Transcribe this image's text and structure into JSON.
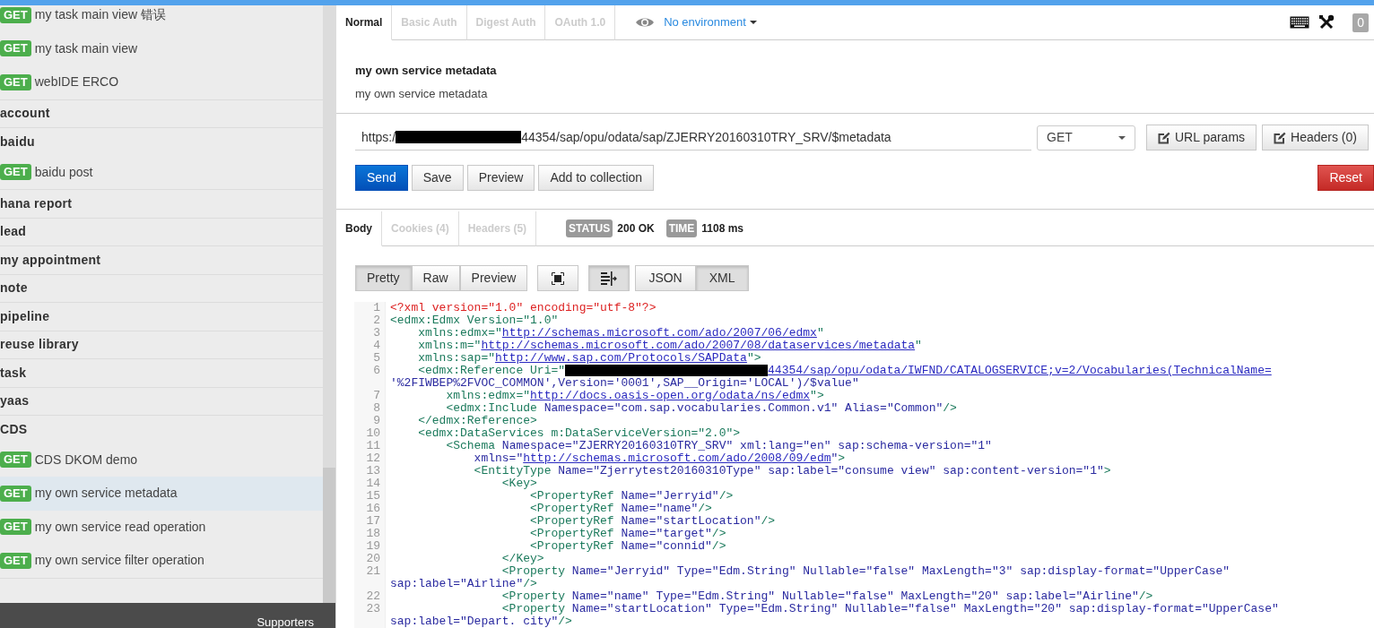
{
  "sidebar": {
    "items": [
      {
        "kind": "request",
        "method": "GET",
        "label": "my task main view 错误",
        "selected": false
      },
      {
        "kind": "request",
        "method": "GET",
        "label": "my task main view",
        "selected": false
      },
      {
        "kind": "request",
        "method": "GET",
        "label": "webIDE ERCO",
        "selected": false
      },
      {
        "kind": "folder",
        "label": "account",
        "selected": false
      },
      {
        "kind": "folder",
        "label": "baidu",
        "selected": false,
        "children": [
          {
            "kind": "request",
            "method": "GET",
            "label": "baidu post",
            "selected": false
          }
        ]
      },
      {
        "kind": "folder",
        "label": "hana report",
        "selected": false
      },
      {
        "kind": "folder",
        "label": "lead",
        "selected": false
      },
      {
        "kind": "folder",
        "label": "my appointment",
        "selected": false
      },
      {
        "kind": "folder",
        "label": "note",
        "selected": false
      },
      {
        "kind": "folder",
        "label": "pipeline",
        "selected": false
      },
      {
        "kind": "folder",
        "label": "reuse library",
        "selected": false
      },
      {
        "kind": "folder",
        "label": "task",
        "selected": false
      },
      {
        "kind": "folder",
        "label": "yaas",
        "selected": false
      },
      {
        "kind": "folder",
        "label": "CDS",
        "selected": false,
        "children": [
          {
            "kind": "request",
            "method": "GET",
            "label": "CDS DKOM demo",
            "selected": false
          },
          {
            "kind": "request",
            "method": "GET",
            "label": "my own service metadata",
            "selected": true
          },
          {
            "kind": "request",
            "method": "GET",
            "label": "my own service read operation",
            "selected": false
          },
          {
            "kind": "request",
            "method": "GET",
            "label": "my own service filter operation",
            "selected": false
          }
        ]
      }
    ],
    "footer": "Supporters"
  },
  "auth_tabs": [
    {
      "label": "Normal",
      "selected": true
    },
    {
      "label": "Basic Auth",
      "selected": false
    },
    {
      "label": "Digest Auth",
      "selected": false
    },
    {
      "label": "OAuth 1.0",
      "selected": false
    }
  ],
  "environment": "No environment",
  "counter": "0",
  "request": {
    "title": "my own service metadata",
    "description": "my own service metadata",
    "url": {
      "prefix": "https:/",
      "redacted": true,
      "suffix": "44354/sap/opu/odata/sap/ZJERRY20160310TRY_SRV/$metadata"
    },
    "method": "GET",
    "url_params": "URL params",
    "headers": "Headers (0)"
  },
  "actions": [
    {
      "label": "Send",
      "kind": "primary"
    },
    {
      "label": "Save",
      "kind": "default"
    },
    {
      "label": "Preview",
      "kind": "default"
    },
    {
      "label": "Add to collection",
      "kind": "default"
    },
    {
      "label": "Reset",
      "kind": "danger"
    }
  ],
  "response": {
    "tabs": [
      {
        "label": "Body",
        "selected": true
      },
      {
        "label": "Cookies (4)",
        "selected": false
      },
      {
        "label": "Headers (5)",
        "selected": false
      }
    ],
    "status_label": "STATUS",
    "status": "200 OK",
    "time_label": "TIME",
    "time": "1108 ms",
    "view_modes": [
      {
        "label": "Pretty",
        "selected": true
      },
      {
        "label": "Raw",
        "selected": false
      },
      {
        "label": "Preview",
        "selected": false
      }
    ],
    "fullscreen_on": false,
    "wrap_on": true,
    "formats": [
      {
        "label": "JSON",
        "selected": false
      },
      {
        "label": "XML",
        "selected": true
      }
    ],
    "code": [
      {
        "number": "1",
        "segments": [
          {
            "kind": "decl",
            "text": "<?xml version=\"1.0\" encoding=\"utf-8\"?>"
          }
        ]
      },
      {
        "number": "2",
        "segments": [
          {
            "kind": "tag",
            "text": "<edmx:Edmx Version=\"1.0\""
          }
        ]
      },
      {
        "number": "3",
        "segments": [
          {
            "kind": "tag",
            "text": "    xmlns:edmx=\""
          },
          {
            "kind": "link",
            "text": "http://schemas.microsoft.com/ado/2007/06/edmx"
          },
          {
            "kind": "tag",
            "text": "\""
          }
        ]
      },
      {
        "number": "4",
        "segments": [
          {
            "kind": "tag",
            "text": "    xmlns:m=\""
          },
          {
            "kind": "link",
            "text": "http://schemas.microsoft.com/ado/2007/08/dataservices/metadata"
          },
          {
            "kind": "tag",
            "text": "\""
          }
        ]
      },
      {
        "number": "5",
        "segments": [
          {
            "kind": "tag",
            "text": "    xmlns:sap=\""
          },
          {
            "kind": "link",
            "text": "http://www.sap.com/Protocols/SAPData"
          },
          {
            "kind": "tag",
            "text": "\">"
          }
        ]
      },
      {
        "number": "6",
        "segments": [
          {
            "kind": "tag",
            "text": "    <edmx:Reference Uri=\""
          },
          {
            "kind": "redacted"
          },
          {
            "kind": "link",
            "text": "44354/sap/opu/odata/IWFND/CATALOGSERVICE;v=2/Vocabularies(TechnicalName="
          }
        ]
      },
      {
        "segments": [
          {
            "kind": "attr",
            "text": "'%2FIWBEP%2FVOC_COMMON',Version='0001',SAP__Origin='LOCAL')/$value\""
          }
        ]
      },
      {
        "number": "7",
        "segments": [
          {
            "kind": "tag",
            "text": "        xmlns:edmx=\""
          },
          {
            "kind": "link",
            "text": "http://docs.oasis-open.org/odata/ns/edmx"
          },
          {
            "kind": "tag",
            "text": "\">"
          }
        ]
      },
      {
        "number": "8",
        "segments": [
          {
            "kind": "tag",
            "text": "        <edmx:Include"
          },
          {
            "kind": "attr",
            "text": " Namespace=\"com.sap.vocabularies.Common.v1\" Alias=\"Common\""
          },
          {
            "kind": "tag",
            "text": "/>"
          }
        ]
      },
      {
        "number": "9",
        "segments": [
          {
            "kind": "tag",
            "text": "    </edmx:Reference>"
          }
        ]
      },
      {
        "number": "10",
        "segments": [
          {
            "kind": "tag",
            "text": "    <edmx:DataServices m:DataServiceVersion=\"2.0\">"
          }
        ]
      },
      {
        "number": "11",
        "segments": [
          {
            "kind": "tag",
            "text": "        <Schema"
          },
          {
            "kind": "attr",
            "text": " Namespace=\"ZJERRY20160310TRY_SRV\" xml:lang=\"en\" sap:schema-version=\"1\""
          }
        ]
      },
      {
        "number": "12",
        "segments": [
          {
            "kind": "attr",
            "text": "            xmlns=\""
          },
          {
            "kind": "link",
            "text": "http://schemas.microsoft.com/ado/2008/09/edm"
          },
          {
            "kind": "attr",
            "text": "\""
          },
          {
            "kind": "tag",
            "text": ">"
          }
        ]
      },
      {
        "number": "13",
        "segments": [
          {
            "kind": "tag",
            "text": "            <EntityType"
          },
          {
            "kind": "attr",
            "text": " Name=\"Zjerrytest20160310Type\" sap:label=\"consume view\" sap:content-version=\"1\""
          },
          {
            "kind": "tag",
            "text": ">"
          }
        ]
      },
      {
        "number": "14",
        "segments": [
          {
            "kind": "tag",
            "text": "                <Key>"
          }
        ]
      },
      {
        "number": "15",
        "segments": [
          {
            "kind": "tag",
            "text": "                    <PropertyRef"
          },
          {
            "kind": "attr",
            "text": " Name=\"Jerryid\""
          },
          {
            "kind": "tag",
            "text": "/>"
          }
        ]
      },
      {
        "number": "16",
        "segments": [
          {
            "kind": "tag",
            "text": "                    <PropertyRef"
          },
          {
            "kind": "attr",
            "text": " Name=\"name\""
          },
          {
            "kind": "tag",
            "text": "/>"
          }
        ]
      },
      {
        "number": "17",
        "segments": [
          {
            "kind": "tag",
            "text": "                    <PropertyRef"
          },
          {
            "kind": "attr",
            "text": " Name=\"startLocation\""
          },
          {
            "kind": "tag",
            "text": "/>"
          }
        ]
      },
      {
        "number": "18",
        "segments": [
          {
            "kind": "tag",
            "text": "                    <PropertyRef"
          },
          {
            "kind": "attr",
            "text": " Name=\"target\""
          },
          {
            "kind": "tag",
            "text": "/>"
          }
        ]
      },
      {
        "number": "19",
        "segments": [
          {
            "kind": "tag",
            "text": "                    <PropertyRef"
          },
          {
            "kind": "attr",
            "text": " Name=\"connid\""
          },
          {
            "kind": "tag",
            "text": "/>"
          }
        ]
      },
      {
        "number": "20",
        "segments": [
          {
            "kind": "tag",
            "text": "                </Key>"
          }
        ]
      },
      {
        "number": "21",
        "segments": [
          {
            "kind": "tag",
            "text": "                <Property"
          },
          {
            "kind": "attr",
            "text": " Name=\"Jerryid\" Type=\"Edm.String\" Nullable=\"false\" MaxLength=\"3\" sap:display-format=\"UpperCase\""
          }
        ]
      },
      {
        "segments": [
          {
            "kind": "attr",
            "text": "sap:label=\"Airline\""
          },
          {
            "kind": "tag",
            "text": "/>"
          }
        ]
      },
      {
        "number": "22",
        "segments": [
          {
            "kind": "tag",
            "text": "                <Property"
          },
          {
            "kind": "attr",
            "text": " Name=\"name\" Type=\"Edm.String\" Nullable=\"false\" MaxLength=\"20\" sap:label=\"Airline\""
          },
          {
            "kind": "tag",
            "text": "/>"
          }
        ]
      },
      {
        "number": "23",
        "segments": [
          {
            "kind": "tag",
            "text": "                <Property"
          },
          {
            "kind": "attr",
            "text": " Name=\"startLocation\" Type=\"Edm.String\" Nullable=\"false\" MaxLength=\"20\" sap:display-format=\"UpperCase\""
          }
        ]
      },
      {
        "segments": [
          {
            "kind": "attr",
            "text": "sap:label=\"Depart. city\""
          },
          {
            "kind": "tag",
            "text": "/>"
          }
        ]
      }
    ]
  }
}
